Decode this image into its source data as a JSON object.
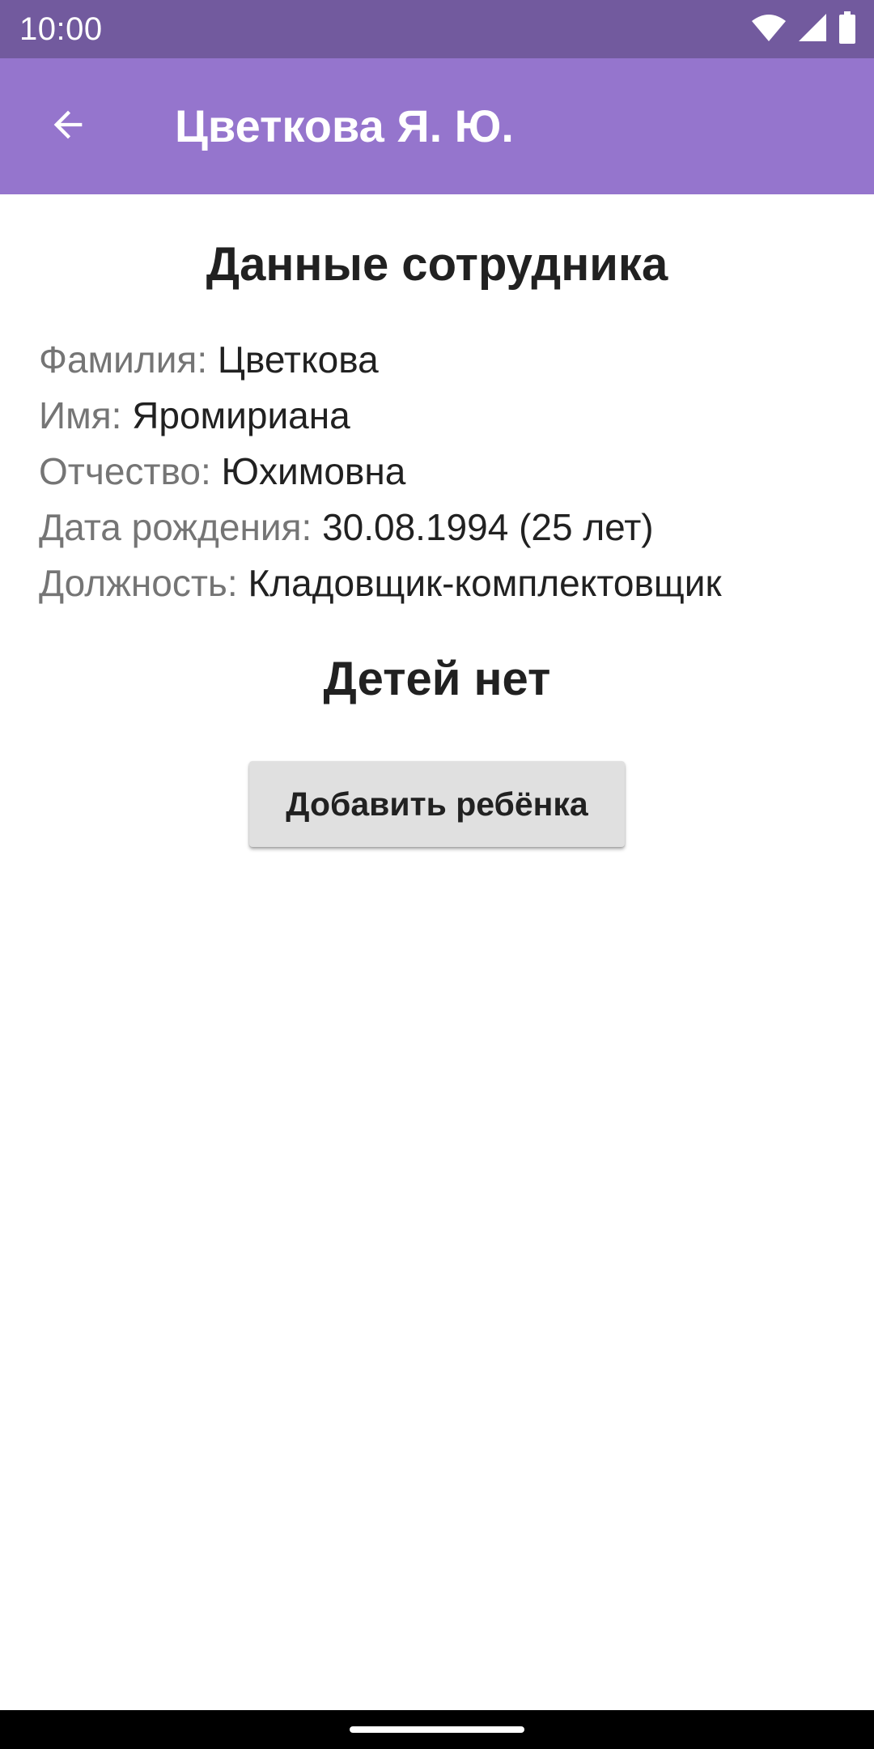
{
  "status_bar": {
    "time": "10:00",
    "icons": [
      "wifi-icon",
      "cell-signal-icon",
      "battery-icon"
    ]
  },
  "app_bar": {
    "back_icon": "arrow-back-icon",
    "title": "Цветкова Я. Ю.",
    "background_color": "#9575cd",
    "status_color": "#725a9e"
  },
  "employee": {
    "heading": "Данные сотрудника",
    "fields": [
      {
        "label": "Фамилия:",
        "value": "Цветкова"
      },
      {
        "label": "Имя:",
        "value": "Яромириана"
      },
      {
        "label": "Отчество:",
        "value": "Юхимовна"
      },
      {
        "label": "Дата рождения:",
        "value": "30.08.1994 (25 лет)"
      },
      {
        "label": "Должность:",
        "value": "Кладовщик-комплектовщик"
      }
    ]
  },
  "children": {
    "heading": "Детей нет",
    "add_button_label": "Добавить ребёнка"
  }
}
